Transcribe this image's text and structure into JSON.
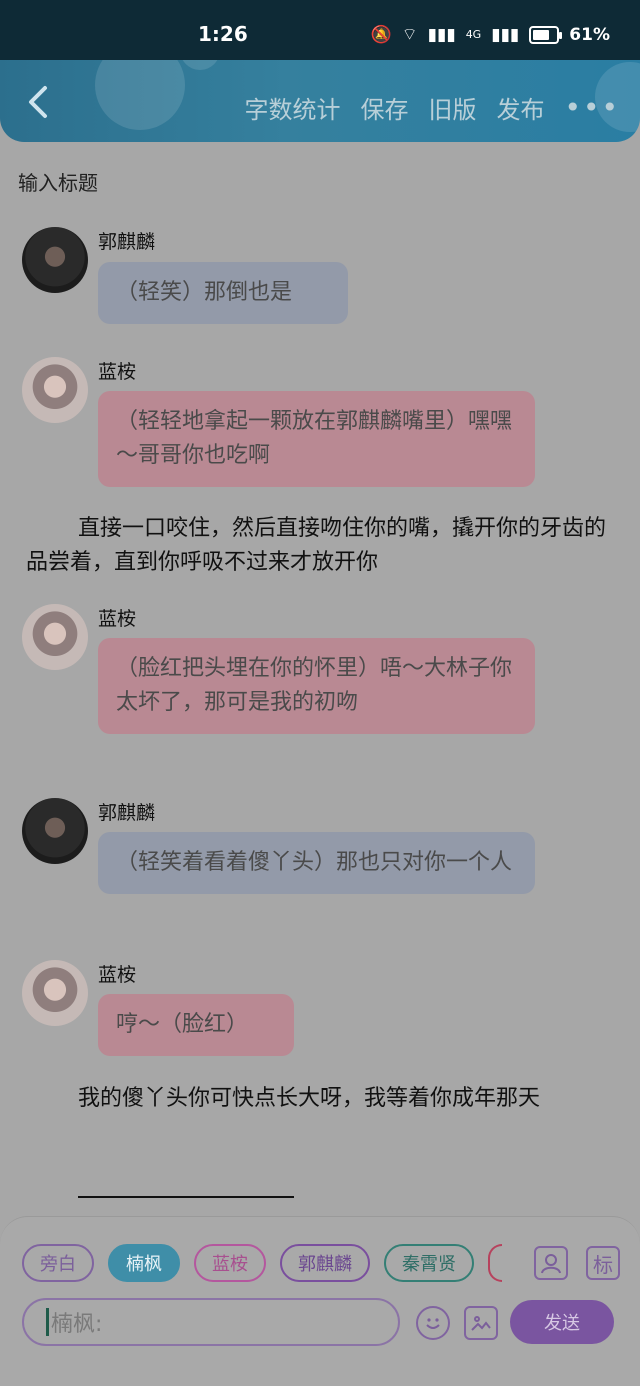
{
  "status_bar": {
    "time": "1:26",
    "battery_pct": "61%",
    "network": "4G"
  },
  "header": {
    "back_icon": "chevron-left-icon",
    "actions": [
      "字数统计",
      "保存",
      "旧版",
      "发布"
    ],
    "more_icon": "more-horizontal-icon"
  },
  "title_placeholder": "输入标题",
  "messages": [
    {
      "speaker": "郭麒麟",
      "text": "（轻笑）那倒也是",
      "style": "blue"
    },
    {
      "speaker": "蓝桉",
      "text": "（轻轻地拿起一颗放在郭麒麟嘴里）嘿嘿～哥哥你也吃啊",
      "style": "pink"
    },
    {
      "narration": "直接一口咬住，然后直接吻住你的嘴，撬开你的牙齿的品尝着，直到你呼吸不过来才放开你"
    },
    {
      "speaker": "蓝桉",
      "text": "（脸红把头埋在你的怀里）唔～大林子你太坏了，那可是我的初吻",
      "style": "pink"
    },
    {
      "speaker": "郭麒麟",
      "text": "（轻笑着看着傻丫头）那也只对你一个人",
      "style": "blue"
    },
    {
      "speaker": "蓝桉",
      "text": "哼～（脸红）",
      "style": "pink"
    },
    {
      "narration": "我的傻丫头你可快点长大呀，我等着你成年那天"
    }
  ],
  "chips": [
    "旁白",
    "楠枫",
    "蓝桉",
    "郭麒麟",
    "秦霄贤"
  ],
  "active_chip": "楠枫",
  "side_icons": {
    "role": "user-icon",
    "mark_label": "标"
  },
  "input": {
    "value": "楠枫:"
  },
  "send_label": "发送",
  "colors": {
    "header": "#2c6f8d",
    "blue_bubble": "#939aa9",
    "pink_bubble": "#b98993",
    "send": "#7a55a0"
  }
}
